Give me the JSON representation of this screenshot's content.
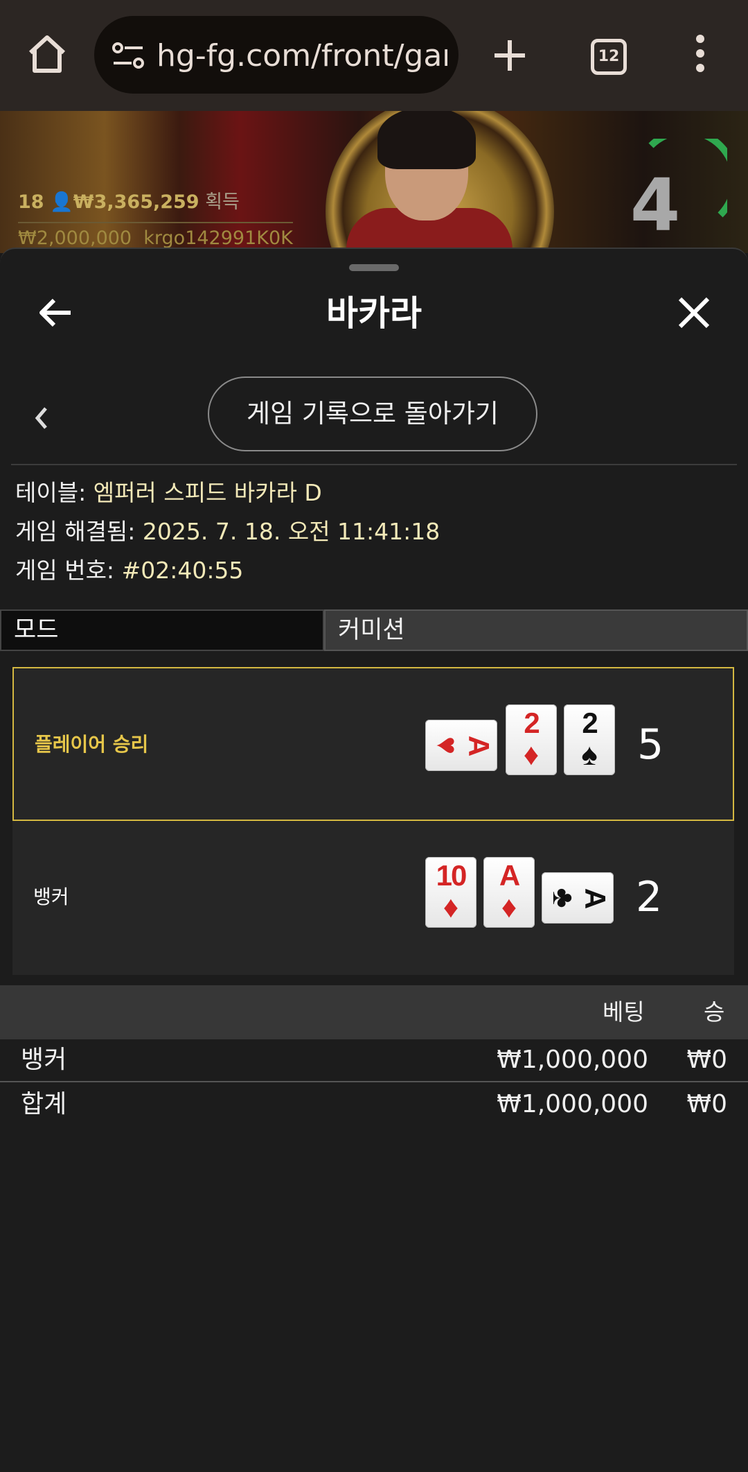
{
  "browser": {
    "url": "hg-fg.com/front/gam",
    "tab_count": "12"
  },
  "video": {
    "players": "18",
    "total": "₩3,365,259",
    "total_suffix": "획득",
    "balance": "₩2,000,000",
    "username": "krgo142991K0K",
    "countdown": "4",
    "timer_color": "#2fa84f"
  },
  "sheet": {
    "title": "바카라",
    "history_button": "게임 기록으로 돌아가기",
    "table_label": "테이블:",
    "table_value": "엠퍼러 스피드 바카라 D",
    "resolved_label": "게임 해결됨:",
    "resolved_value": "2025. 7. 18. 오전 11:41:18",
    "game_no_label": "게임 번호:",
    "game_no_value": "#02:40:55",
    "mode_label": "모드",
    "mode_value": "커미션"
  },
  "hands": {
    "player": {
      "label": "플레이어 승리",
      "total": "5",
      "cards": [
        {
          "rank": "A",
          "suit": "♥",
          "color": "red",
          "orientation": "sideways"
        },
        {
          "rank": "2",
          "suit": "♦",
          "color": "red",
          "orientation": "upright"
        },
        {
          "rank": "2",
          "suit": "♠",
          "color": "black",
          "orientation": "upright"
        }
      ]
    },
    "banker": {
      "label": "뱅커",
      "total": "2",
      "cards": [
        {
          "rank": "10",
          "suit": "♦",
          "color": "red",
          "orientation": "upright"
        },
        {
          "rank": "A",
          "suit": "♦",
          "color": "red",
          "orientation": "upright"
        },
        {
          "rank": "A",
          "suit": "♣",
          "color": "black",
          "orientation": "sideways"
        }
      ]
    },
    "winner_border_color": "#d4b841"
  },
  "bets": {
    "header_bet": "베팅",
    "header_win": "승",
    "rows": [
      {
        "name": "뱅커",
        "bet": "₩1,000,000",
        "win": "₩0"
      },
      {
        "name": "합계",
        "bet": "₩1,000,000",
        "win": "₩0"
      }
    ]
  }
}
